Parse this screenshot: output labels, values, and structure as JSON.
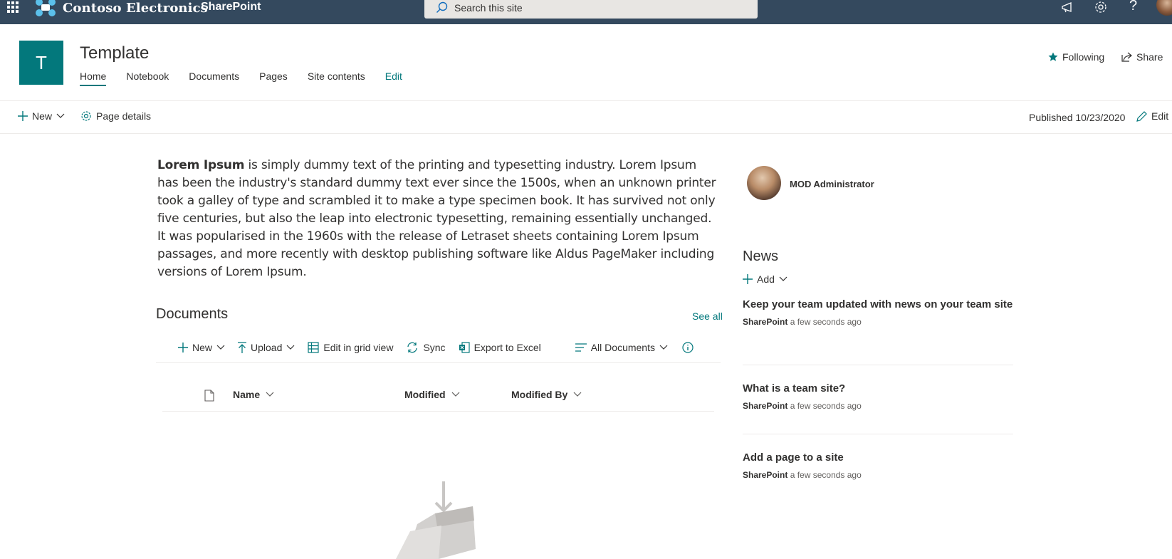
{
  "suite_bar": {
    "brand": "Contoso Electronics",
    "app": "SharePoint",
    "search_placeholder": "Search this site",
    "icons": [
      "waffle-icon",
      "megaphone-icon",
      "settings-icon",
      "help-icon"
    ]
  },
  "site": {
    "logo_letter": "T",
    "title": "Template",
    "nav": [
      {
        "label": "Home",
        "active": true
      },
      {
        "label": "Notebook"
      },
      {
        "label": "Documents"
      },
      {
        "label": "Pages"
      },
      {
        "label": "Site contents"
      },
      {
        "label": "Edit",
        "is_edit": true
      }
    ],
    "following_label": "Following",
    "share_label": "Share",
    "accent_color": "#03787c"
  },
  "command_bar": {
    "new_label": "New",
    "page_details_label": "Page details",
    "published": "Published 10/23/2020",
    "edit_label": "Edit"
  },
  "content": {
    "lorem_lead": "Lorem Ipsum",
    "lorem_body": " is simply dummy text of the printing and typesetting industry. Lorem Ipsum has been the industry's standard dummy text ever since the 1500s, when an unknown printer took a galley of type and scrambled it to make a type specimen book. It has survived not only five centuries, but also the leap into electronic typesetting, remaining essentially unchanged. It was popularised in the 1960s with the release of Letraset sheets containing Lorem Ipsum passages, and more recently with desktop publishing software like Aldus PageMaker including versions of Lorem Ipsum."
  },
  "documents": {
    "title": "Documents",
    "see_all": "See all",
    "commands": {
      "new": "New",
      "upload": "Upload",
      "grid": "Edit in grid view",
      "sync": "Sync",
      "export": "Export to Excel",
      "view": "All Documents"
    },
    "columns": {
      "name": "Name",
      "modified": "Modified",
      "modified_by": "Modified By"
    }
  },
  "sidebar": {
    "profile_name": "MOD Administrator",
    "news": {
      "title": "News",
      "add_label": "Add",
      "items": [
        {
          "headline": "Keep your team updated with news on your team site",
          "source": "SharePoint",
          "time": "a few seconds ago"
        },
        {
          "headline": "What is a team site?",
          "source": "SharePoint",
          "time": "a few seconds ago"
        },
        {
          "headline": "Add a page to a site",
          "source": "SharePoint",
          "time": "a few seconds ago"
        }
      ]
    }
  }
}
